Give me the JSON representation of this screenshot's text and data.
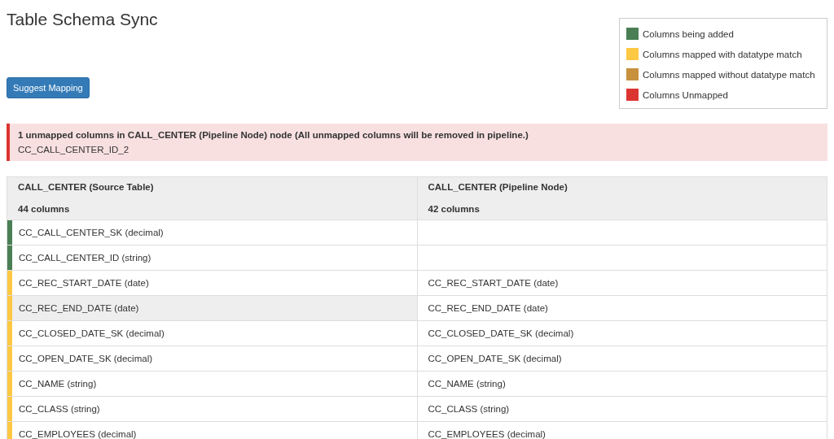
{
  "title": "Table Schema Sync",
  "legend": [
    {
      "label": "Columns being added",
      "color": "#4a7f55"
    },
    {
      "label": "Columns mapped with datatype match",
      "color": "#fdc843"
    },
    {
      "label": "Columns mapped without datatype match",
      "color": "#c8913e"
    },
    {
      "label": "Columns Unmapped",
      "color": "#dc3531"
    }
  ],
  "suggest_button": "Suggest Mapping",
  "alert": {
    "message": "1 unmapped columns in CALL_CENTER (Pipeline Node) node (All unmapped columns will be removed in pipeline.)",
    "items": [
      "CC_CALL_CENTER_ID_2"
    ]
  },
  "table": {
    "columns": [
      {
        "title": "CALL_CENTER (Source Table)",
        "count": "44 columns"
      },
      {
        "title": "CALL_CENTER (Pipeline Node)",
        "count": "42 columns"
      }
    ],
    "rows": [
      {
        "source": "CC_CALL_CENTER_SK (decimal)",
        "target": "",
        "color": "#4a7f55",
        "highlighted": false
      },
      {
        "source": "CC_CALL_CENTER_ID (string)",
        "target": "",
        "color": "#4a7f55",
        "highlighted": false
      },
      {
        "source": "CC_REC_START_DATE (date)",
        "target": "CC_REC_START_DATE (date)",
        "color": "#fdc843",
        "highlighted": false
      },
      {
        "source": "CC_REC_END_DATE (date)",
        "target": "CC_REC_END_DATE (date)",
        "color": "#fdc843",
        "highlighted": true
      },
      {
        "source": "CC_CLOSED_DATE_SK (decimal)",
        "target": "CC_CLOSED_DATE_SK (decimal)",
        "color": "#fdc843",
        "highlighted": false
      },
      {
        "source": "CC_OPEN_DATE_SK (decimal)",
        "target": "CC_OPEN_DATE_SK (decimal)",
        "color": "#fdc843",
        "highlighted": false
      },
      {
        "source": "CC_NAME (string)",
        "target": "CC_NAME (string)",
        "color": "#fdc843",
        "highlighted": false
      },
      {
        "source": "CC_CLASS (string)",
        "target": "CC_CLASS (string)",
        "color": "#fdc843",
        "highlighted": false
      },
      {
        "source": "CC_EMPLOYEES (decimal)",
        "target": "CC_EMPLOYEES (decimal)",
        "color": "#fdc843",
        "highlighted": false
      }
    ]
  }
}
